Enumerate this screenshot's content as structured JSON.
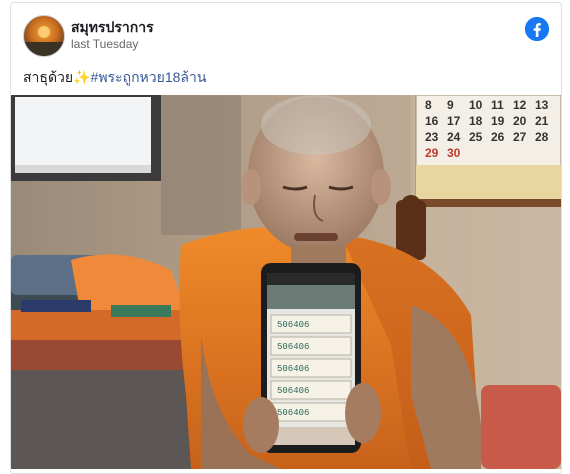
{
  "post": {
    "author": "สมุทรปราการ",
    "timestamp": "last Tuesday",
    "caption_text": "สาธุด้วย",
    "caption_emoji": "✨",
    "hashtag": "#พระถูกหวย18ล้าน"
  },
  "icons": {
    "platform": "facebook-icon"
  },
  "colors": {
    "brand": "#1877f2",
    "hashtag": "#385898",
    "robe": "#e07a1f"
  },
  "photo": {
    "calendar_numbers": [
      [
        "8",
        "9",
        "10",
        "11",
        "12",
        "13"
      ],
      [
        "16",
        "17",
        "18",
        "19",
        "20",
        "21"
      ],
      [
        "23",
        "24",
        "25",
        "26",
        "27",
        "28"
      ],
      [
        "29",
        "30"
      ]
    ],
    "ticket_numbers": [
      "506406",
      "506406",
      "506406",
      "506406",
      "506406"
    ]
  }
}
